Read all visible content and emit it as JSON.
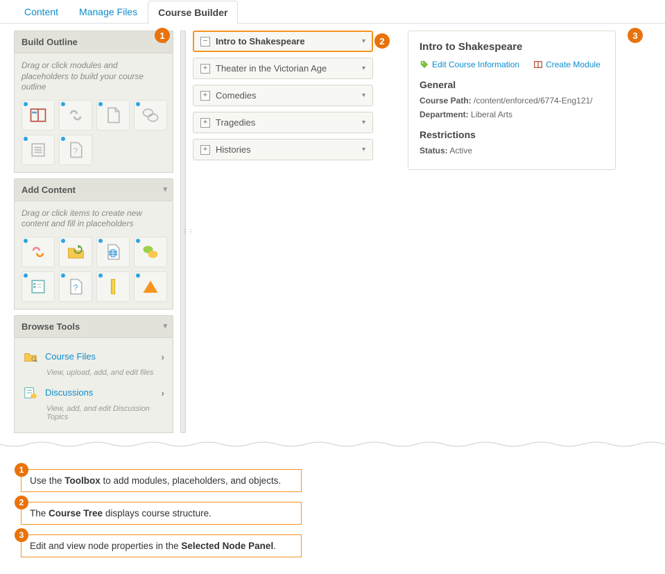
{
  "tabs": {
    "content": "Content",
    "manage_files": "Manage Files",
    "course_builder": "Course Builder"
  },
  "toolbox": {
    "build_outline": {
      "title": "Build Outline",
      "hint": "Drag or click modules and placeholders to build your course outline",
      "icons": [
        "module",
        "link",
        "file",
        "discussion",
        "checklist",
        "unknown-file"
      ]
    },
    "add_content": {
      "title": "Add Content",
      "hint": "Drag or click items to create new content and fill in placeholders",
      "icons": [
        "link",
        "folder",
        "global-file",
        "chat",
        "checklist",
        "unknown-file",
        "ruler",
        "warn"
      ]
    },
    "browse_tools": {
      "title": "Browse Tools",
      "course_files": {
        "label": "Course Files",
        "sub": "View, upload, add, and edit files"
      },
      "discussions": {
        "label": "Discussions",
        "sub": "View, add, and edit Discussion Topics"
      }
    }
  },
  "tree": {
    "root": "Intro to Shakespeare",
    "nodes": [
      "Theater in the Victorian Age",
      "Comedies",
      "Tragedies",
      "Histories"
    ]
  },
  "detail": {
    "title": "Intro to Shakespeare",
    "edit_link": "Edit Course Information",
    "create_link": "Create Module",
    "general_heading": "General",
    "course_path_label": "Course Path:",
    "course_path_value": "/content/enforced/6774-Eng121/",
    "department_label": "Department:",
    "department_value": "Liberal Arts",
    "restrictions_heading": "Restrictions",
    "status_label": "Status:",
    "status_value": "Active"
  },
  "annotations": {
    "a1_pre": "Use the ",
    "a1_bold": "Toolbox",
    "a1_post": " to add modules, placeholders, and objects.",
    "a2_pre": "The ",
    "a2_bold": "Course Tree",
    "a2_post": " displays course structure.",
    "a3_pre": "Edit and view node properties in the ",
    "a3_bold": "Selected Node Panel",
    "a3_post": "."
  },
  "badges": {
    "b1": "1",
    "b2": "2",
    "b3": "3"
  }
}
